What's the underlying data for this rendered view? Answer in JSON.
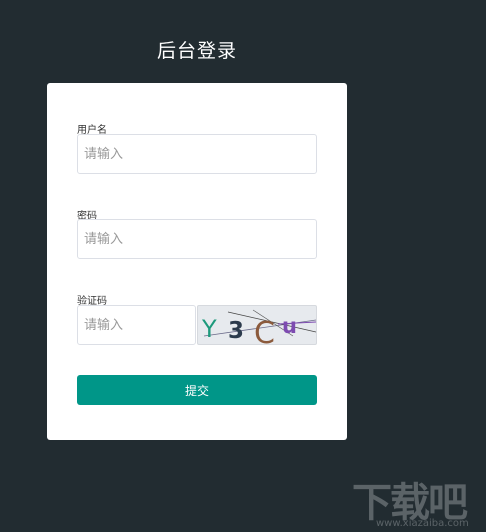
{
  "page": {
    "title": "后台登录"
  },
  "form": {
    "username": {
      "label": "用户名",
      "placeholder": "请输入",
      "value": ""
    },
    "password": {
      "label": "密码",
      "placeholder": "请输入",
      "value": ""
    },
    "captcha": {
      "label": "验证码",
      "placeholder": "请输入",
      "value": "",
      "image_text": [
        "Y",
        "3",
        "C",
        "u"
      ],
      "colors": [
        "#1d9a7c",
        "#2b3a4c",
        "#8b5a3c",
        "#7d4bb0"
      ]
    },
    "submit_label": "提交"
  },
  "watermark": {
    "text": "下载吧",
    "url": "www.xiazaiba.com"
  },
  "colors": {
    "background": "#222c31",
    "accent": "#009688",
    "card": "#ffffff"
  }
}
